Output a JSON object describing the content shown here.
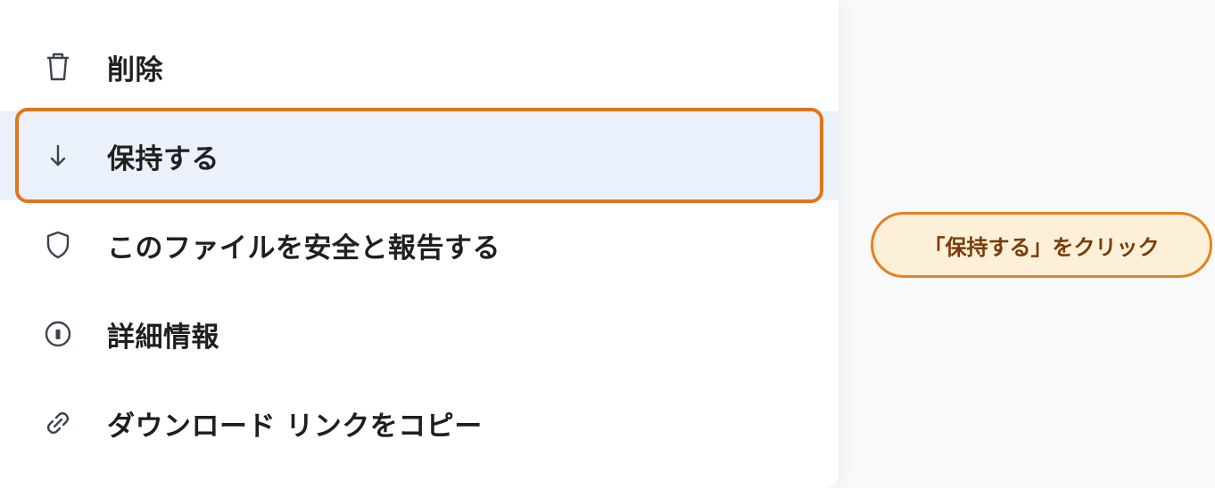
{
  "menu": {
    "items": [
      {
        "label": "削除",
        "icon": "trash-icon"
      },
      {
        "label": "保持する",
        "icon": "arrow-down-icon",
        "selected": true
      },
      {
        "label": "このファイルを安全と報告する",
        "icon": "shield-icon"
      },
      {
        "label": "詳細情報",
        "icon": "info-icon"
      },
      {
        "label": "ダウンロード リンクをコピー",
        "icon": "link-icon"
      }
    ]
  },
  "callout": {
    "text": "「保持する」をクリック"
  },
  "colors": {
    "highlight": "#e0761a",
    "selected_bg": "#eaf1fb",
    "callout_bg": "#fdf0d8",
    "callout_text": "#7a3b06"
  }
}
